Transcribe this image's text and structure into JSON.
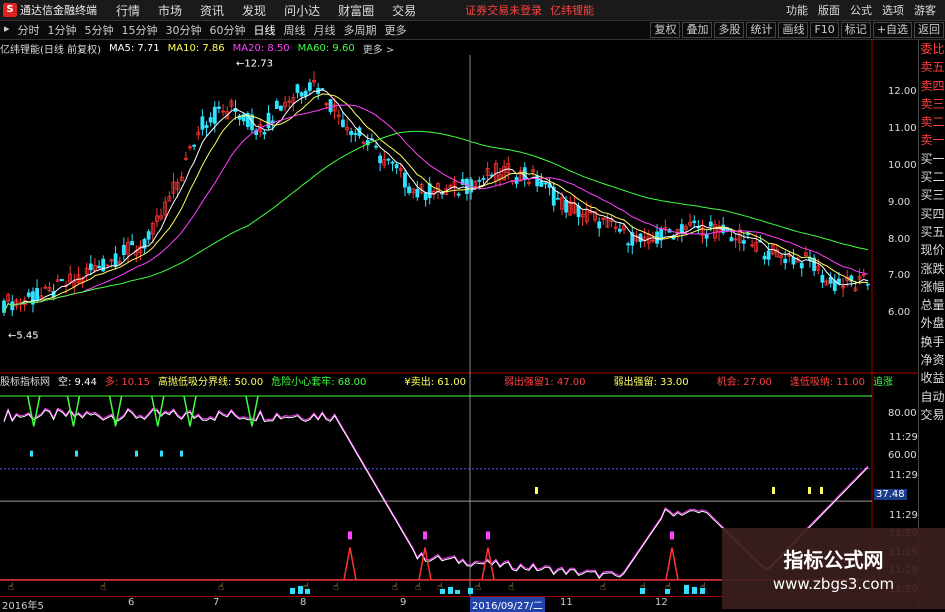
{
  "titlebar": {
    "logo": "S",
    "app_name": "通达信金融终端",
    "menu": [
      "行情",
      "市场",
      "资讯",
      "发现",
      "问小达",
      "财富圈",
      "交易"
    ],
    "status": "证券交易未登录",
    "stock": "亿纬锂能",
    "right_menu": [
      "功能",
      "版面",
      "公式",
      "选项",
      "游客"
    ]
  },
  "periodbar": {
    "periods": [
      "分时",
      "1分钟",
      "5分钟",
      "15分钟",
      "30分钟",
      "60分钟",
      "日线",
      "周线",
      "月线",
      "多周期",
      "更多"
    ],
    "active": "日线",
    "tools": [
      "复权",
      "叠加",
      "多股",
      "统计",
      "画线",
      "F10",
      "标记",
      "+自选",
      "返回"
    ]
  },
  "infobar": {
    "title": "亿纬锂能(日线 前复权)",
    "ma5": "MA5: 7.71",
    "ma10": "MA10: 7.86",
    "ma20": "MA20: 8.50",
    "ma60": "MA60: 9.60",
    "colors": {
      "ma5": "#ffffff",
      "ma10": "#ffff60",
      "ma20": "#ff40ff",
      "ma60": "#40ff40"
    }
  },
  "main_axis": {
    "labels": [
      "12.00",
      "11.00",
      "10.00",
      "9.00",
      "8.00",
      "7.00",
      "6.00"
    ],
    "high_label": "12.73",
    "low_label": "5.45"
  },
  "indicator_bar": {
    "name": "股标指标网",
    "kong": "空: 9.44",
    "duo": "多: 10.15",
    "boundary": "高抛低吸分界线: 50.00",
    "danger": "危险小心套牢: 68.00",
    "sell": "¥卖出: 61.00",
    "weak": "弱出强留1: 47.00",
    "weak2": "弱出强留: 33.00",
    "chance": "机会: 27.00",
    "bottom": "逢低吸纳: 11.00",
    "strong": "追涨"
  },
  "ind_axis": {
    "labels": [
      "80.00",
      "60.00",
      "37.48"
    ],
    "right_time": "11:29"
  },
  "sidebar": [
    "委比",
    "卖五",
    "卖四",
    "卖三",
    "卖二",
    "卖一",
    "买一",
    "买二",
    "买三",
    "买四",
    "买五",
    "现价",
    "涨跌",
    "涨幅",
    "总量",
    "外盘",
    "换手",
    "净资",
    "收益",
    "自动",
    "交易"
  ],
  "dates": {
    "labels": [
      "2016年5",
      "6",
      "7",
      "8",
      "9",
      "2016/09/27/二",
      "11",
      "12"
    ],
    "cursor": "2016/09/27/二"
  },
  "watermark": {
    "line1": "指标公式网",
    "line2": "www.zbgs3.com"
  },
  "chart_data": {
    "type": "candlestick",
    "ylim": [
      5.3,
      12.9
    ],
    "ma5_last": 7.71,
    "ma10_last": 7.86,
    "ma20_last": 8.5,
    "ma60_last": 9.6,
    "high": 12.73,
    "low": 5.45
  }
}
